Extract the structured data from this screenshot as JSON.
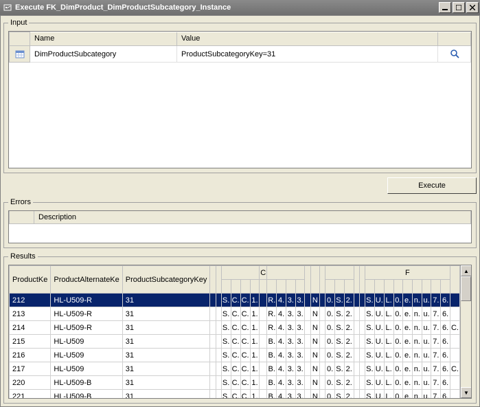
{
  "window": {
    "title": "Execute FK_DimProduct_DimProductSubcategory_Instance"
  },
  "input_panel": {
    "legend": "Input",
    "columns": {
      "name": "Name",
      "value": "Value"
    },
    "rows": [
      {
        "name": "DimProductSubcategory",
        "value": "ProductSubcategoryKey=31"
      }
    ]
  },
  "buttons": {
    "execute": "Execute"
  },
  "errors_panel": {
    "legend": "Errors",
    "columns": {
      "description": "Description"
    }
  },
  "results_panel": {
    "legend": "Results",
    "headers_row1": {
      "productKey": "ProductKe",
      "productAlternateKey": "ProductAlternateKe",
      "productSubcategoryKey": "ProductSubcategoryKey",
      "groupC": "C",
      "groupF": "F"
    },
    "rows": [
      {
        "pk": "212",
        "pak": "HL-U509-R",
        "psk": "31",
        "a": "",
        "b": "",
        "c": "S.",
        "d": "C.",
        "e": "C.",
        "f": "1.",
        "g": "",
        "h": "R.",
        "i": "4.",
        "j": "3.",
        "k": "3.",
        "l": "",
        "m": "N",
        "n": "",
        "o": "0.",
        "p": "S.",
        "q": "2.",
        "r": "",
        "s": "",
        "t": "S.",
        "u": "U.",
        "v": "L.",
        "w": "0.",
        "x": "e.",
        "y": "n.",
        "z": "u.",
        "aa": "7.",
        "ab": "6.",
        "ac": ""
      },
      {
        "pk": "213",
        "pak": "HL-U509-R",
        "psk": "31",
        "a": "",
        "b": "",
        "c": "S.",
        "d": "C.",
        "e": "C.",
        "f": "1.",
        "g": "",
        "h": "R.",
        "i": "4.",
        "j": "3.",
        "k": "3.",
        "l": "",
        "m": "N",
        "n": "",
        "o": "0.",
        "p": "S.",
        "q": "2.",
        "r": "",
        "s": "",
        "t": "S.",
        "u": "U.",
        "v": "L.",
        "w": "0.",
        "x": "e.",
        "y": "n.",
        "z": "u.",
        "aa": "7.",
        "ab": "6.",
        "ac": ""
      },
      {
        "pk": "214",
        "pak": "HL-U509-R",
        "psk": "31",
        "a": "",
        "b": "",
        "c": "S.",
        "d": "C.",
        "e": "C.",
        "f": "1.",
        "g": "",
        "h": "R.",
        "i": "4.",
        "j": "3.",
        "k": "3.",
        "l": "",
        "m": "N",
        "n": "",
        "o": "0.",
        "p": "S.",
        "q": "2.",
        "r": "",
        "s": "",
        "t": "S.",
        "u": "U.",
        "v": "L.",
        "w": "0.",
        "x": "e.",
        "y": "n.",
        "z": "u.",
        "aa": "7.",
        "ab": "6.",
        "ac": "C."
      },
      {
        "pk": "215",
        "pak": "HL-U509",
        "psk": "31",
        "a": "",
        "b": "",
        "c": "S.",
        "d": "C.",
        "e": "C.",
        "f": "1.",
        "g": "",
        "h": "B.",
        "i": "4.",
        "j": "3.",
        "k": "3.",
        "l": "",
        "m": "N",
        "n": "",
        "o": "0.",
        "p": "S.",
        "q": "2.",
        "r": "",
        "s": "",
        "t": "S.",
        "u": "U.",
        "v": "L.",
        "w": "0.",
        "x": "e.",
        "y": "n.",
        "z": "u.",
        "aa": "7.",
        "ab": "6.",
        "ac": ""
      },
      {
        "pk": "216",
        "pak": "HL-U509",
        "psk": "31",
        "a": "",
        "b": "",
        "c": "S.",
        "d": "C.",
        "e": "C.",
        "f": "1.",
        "g": "",
        "h": "B.",
        "i": "4.",
        "j": "3.",
        "k": "3.",
        "l": "",
        "m": "N",
        "n": "",
        "o": "0.",
        "p": "S.",
        "q": "2.",
        "r": "",
        "s": "",
        "t": "S.",
        "u": "U.",
        "v": "L.",
        "w": "0.",
        "x": "e.",
        "y": "n.",
        "z": "u.",
        "aa": "7.",
        "ab": "6.",
        "ac": ""
      },
      {
        "pk": "217",
        "pak": "HL-U509",
        "psk": "31",
        "a": "",
        "b": "",
        "c": "S.",
        "d": "C.",
        "e": "C.",
        "f": "1.",
        "g": "",
        "h": "B.",
        "i": "4.",
        "j": "3.",
        "k": "3.",
        "l": "",
        "m": "N",
        "n": "",
        "o": "0.",
        "p": "S.",
        "q": "2.",
        "r": "",
        "s": "",
        "t": "S.",
        "u": "U.",
        "v": "L.",
        "w": "0.",
        "x": "e.",
        "y": "n.",
        "z": "u.",
        "aa": "7.",
        "ab": "6.",
        "ac": "C."
      },
      {
        "pk": "220",
        "pak": "HL-U509-B",
        "psk": "31",
        "a": "",
        "b": "",
        "c": "S.",
        "d": "C.",
        "e": "C.",
        "f": "1.",
        "g": "",
        "h": "B.",
        "i": "4.",
        "j": "3.",
        "k": "3.",
        "l": "",
        "m": "N",
        "n": "",
        "o": "0.",
        "p": "S.",
        "q": "2.",
        "r": "",
        "s": "",
        "t": "S.",
        "u": "U.",
        "v": "L.",
        "w": "0.",
        "x": "e.",
        "y": "n.",
        "z": "u.",
        "aa": "7.",
        "ab": "6.",
        "ac": ""
      },
      {
        "pk": "221",
        "pak": "HL-U509-B",
        "psk": "31",
        "a": "",
        "b": "",
        "c": "S.",
        "d": "C.",
        "e": "C.",
        "f": "1.",
        "g": "",
        "h": "B.",
        "i": "4.",
        "j": "3.",
        "k": "3.",
        "l": "",
        "m": "N",
        "n": "",
        "o": "0.",
        "p": "S.",
        "q": "2.",
        "r": "",
        "s": "",
        "t": "S.",
        "u": "U.",
        "v": "L.",
        "w": "0.",
        "x": "e.",
        "y": "n.",
        "z": "u.",
        "aa": "7.",
        "ab": "6.",
        "ac": ""
      }
    ]
  }
}
